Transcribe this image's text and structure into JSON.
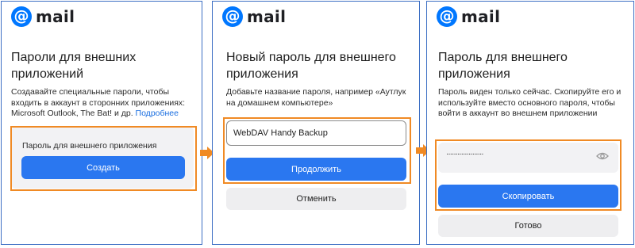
{
  "logo_text": "mail",
  "logo_symbol": "@",
  "panel1": {
    "title": "Пароли для внешних приложений",
    "desc": "Создавайте специальные пароли, чтобы входить в аккаунт в сторонних приложениях: Microsoft Outlook, The Bat! и др.",
    "link": "Подробнее",
    "box_label": "Пароль для внешнего приложения",
    "button": "Создать"
  },
  "panel2": {
    "title": "Новый пароль для внешнего приложения",
    "desc": "Добавьте название пароля, например «Аутлук на домашнем компьютере»",
    "input_value": "WebDAV Handy Backup",
    "continue_button": "Продолжить",
    "cancel_button": "Отменить"
  },
  "panel3": {
    "title": "Пароль для внешнего приложения",
    "desc": "Пароль виден только сейчас. Скопируйте его и используйте вместо основного пароля, чтобы войти в аккаунт во внешнем приложении",
    "password_mask": "····················",
    "copy_button": "Скопировать",
    "done_button": "Готово"
  },
  "colors": {
    "accent": "#2a77f0",
    "highlight": "#f08a24",
    "brand": "#0077ff"
  },
  "icons": [
    "at-logo-icon",
    "arrow-right-icon",
    "eye-icon"
  ]
}
